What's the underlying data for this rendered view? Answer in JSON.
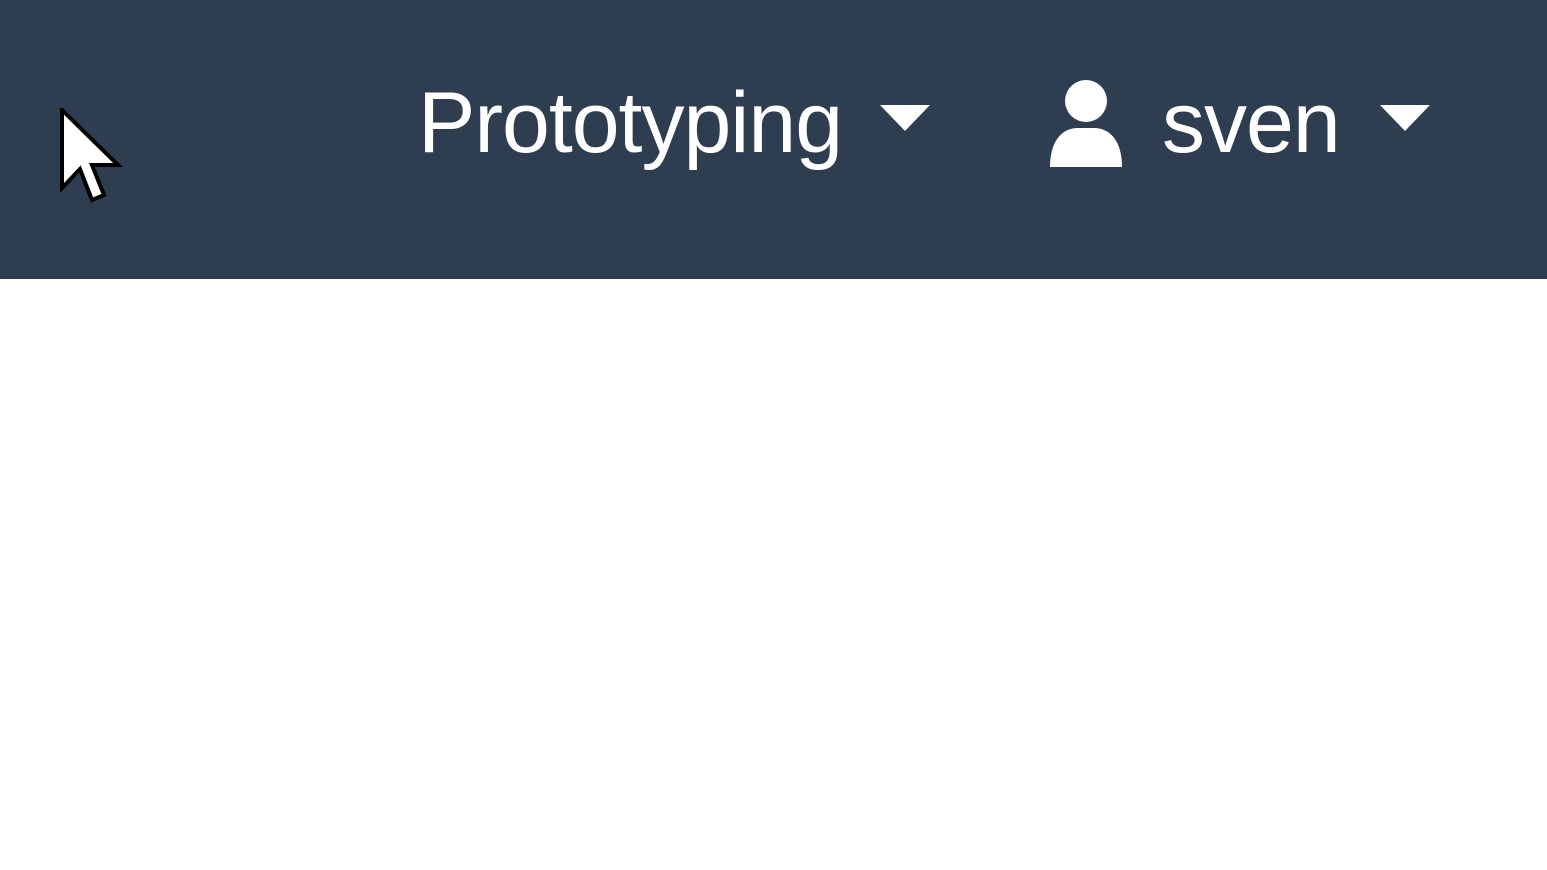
{
  "navbar": {
    "project_menu": {
      "label": "Prototyping",
      "icon": "caret-down-icon"
    },
    "user_menu": {
      "label": "sven",
      "avatar_icon": "user-icon",
      "icon": "caret-down-icon"
    }
  },
  "colors": {
    "navbar_background": "#2e3d50",
    "navbar_text": "#ffffff",
    "page_background": "#ffffff"
  },
  "cursor": {
    "icon": "mouse-pointer-icon"
  }
}
